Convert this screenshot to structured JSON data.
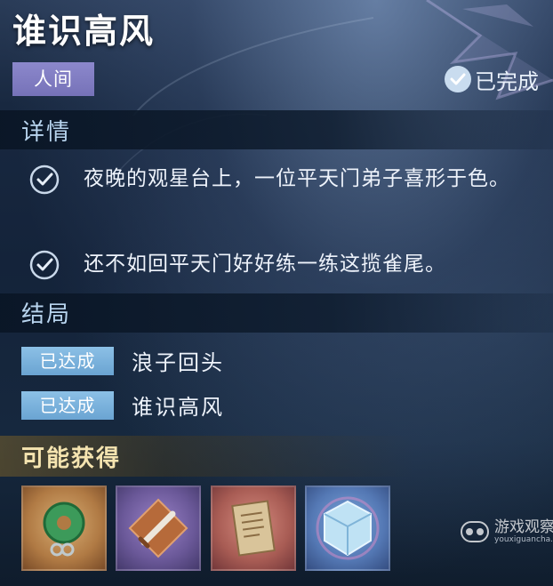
{
  "quest": {
    "title": "谁识高风",
    "region": "人间",
    "status": "已完成"
  },
  "details": {
    "heading": "详情",
    "items": [
      {
        "text": "夜晚的观星台上，一位平天门弟子喜形于色。"
      },
      {
        "text": "还不如回平天门好好练一练这揽雀尾。"
      }
    ]
  },
  "endings": {
    "heading": "结局",
    "items": [
      {
        "badge": "已达成",
        "text": "浪子回头"
      },
      {
        "badge": "已达成",
        "text": "谁识高风"
      }
    ]
  },
  "rewards": {
    "heading": "可能获得",
    "items": [
      {
        "icon": "jade-pendant-icon"
      },
      {
        "icon": "dagger-icon"
      },
      {
        "icon": "scroll-icon"
      },
      {
        "icon": "crystal-cube-icon"
      }
    ]
  },
  "watermark": {
    "name": "游戏观察",
    "url": "youxiguancha.com"
  },
  "colors": {
    "region_tag": "#7e7ac0",
    "achieved_badge": "#7ab2dc",
    "section_title": "#b8d4ee",
    "rewards_title": "#f5e4b0"
  }
}
